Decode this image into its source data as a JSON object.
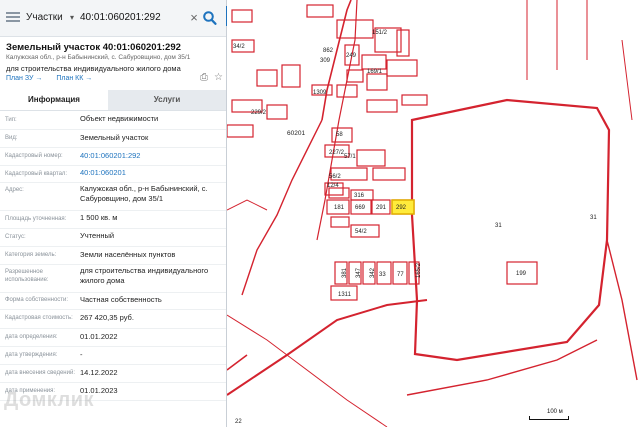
{
  "search": {
    "layer": "Участки",
    "query": "40:01:060201:292"
  },
  "parcel": {
    "title": "Земельный участок 40:01:060201:292",
    "address_short": "Калужская обл., р-н Бабынинский, с. Сабуровщино, дом 35/1",
    "purpose": "для строительства индивидуального жилого дома",
    "plan_zu": "План ЗУ →",
    "plan_kk": "План КК →"
  },
  "tabs": {
    "info": "Информация",
    "services": "Услуги"
  },
  "rows": [
    {
      "label": "Тип:",
      "value": "Объект недвижимости"
    },
    {
      "label": "Вид:",
      "value": "Земельный участок"
    },
    {
      "label": "Кадастровый номер:",
      "value": "40:01:060201:292"
    },
    {
      "label": "Кадастровый квартал:",
      "value": "40:01:060201"
    },
    {
      "label": "Адрес:",
      "value": "Калужская обл., р-н Бабынинский, с. Сабуровщино, дом 35/1"
    },
    {
      "label": "Площадь уточненная:",
      "value": "1 500 кв. м"
    },
    {
      "label": "Статус:",
      "value": "Учтенный"
    },
    {
      "label": "Категория земель:",
      "value": "Земли населённых пунктов"
    },
    {
      "label": "Разрешенное использование:",
      "value": "для строительства индивидуального жилого дома"
    },
    {
      "label": "Форма собственности:",
      "value": "Частная собственность"
    },
    {
      "label": "Кадастровая стоимость:",
      "value": "267 420,35 руб."
    },
    {
      "label": "дата определения:",
      "value": "01.01.2022"
    },
    {
      "label": "дата утверждения:",
      "value": "-"
    },
    {
      "label": "дата внесения сведений:",
      "value": "14.12.2022"
    },
    {
      "label": "дата применения:",
      "value": "01.01.2023"
    }
  ],
  "watermark": "Домклик",
  "map": {
    "scale": "100 м",
    "quarter_label": "60201",
    "selected_label": "292",
    "labels": [
      "151/2",
      "34/2",
      "862",
      "309",
      "249",
      "169/1",
      "1309",
      "229/2",
      "58",
      "227/2",
      "57/1",
      "56/2",
      "12/4",
      "316",
      "181",
      "669",
      "291",
      "292",
      "54/2",
      "31",
      "31",
      "199",
      "381",
      "347",
      "342",
      "33",
      "77",
      "165/2",
      "1311",
      "22"
    ],
    "colors": {
      "boundary": "#d4232f",
      "selected_fill": "#ffeb3b",
      "selected_stroke": "#e0b000"
    }
  }
}
